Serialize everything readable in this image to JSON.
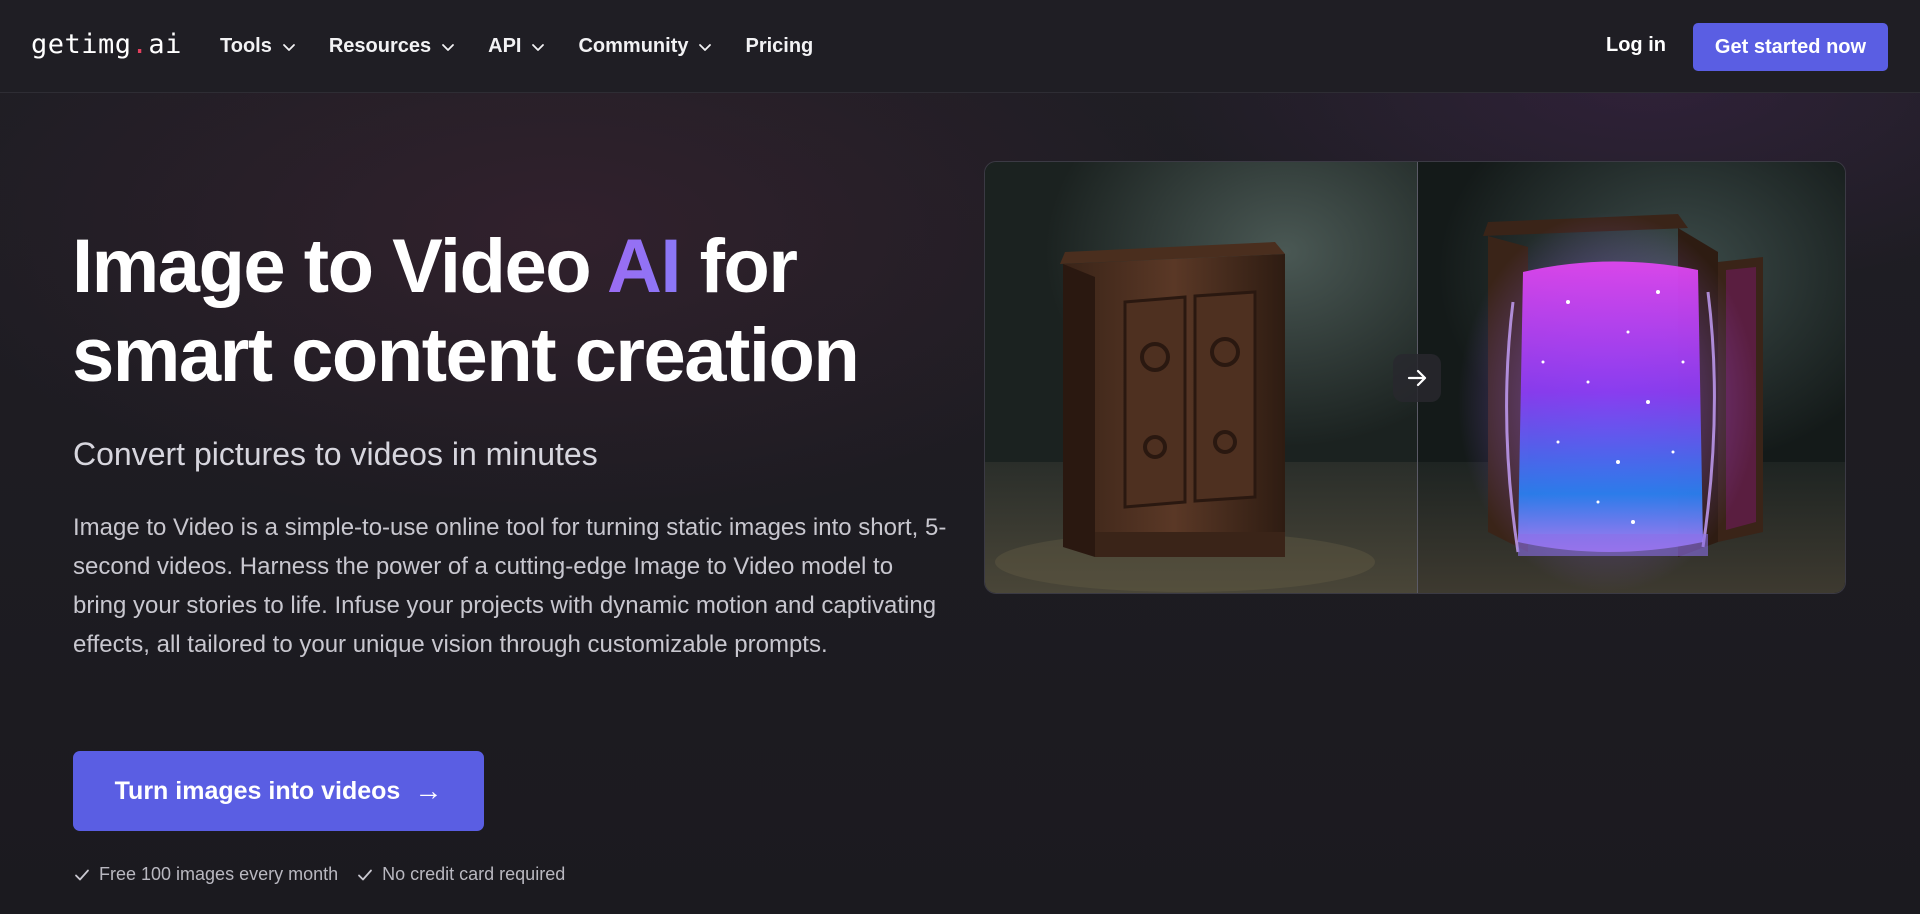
{
  "nav": {
    "logo_prefix": "getimg",
    "logo_dot": ".",
    "logo_suffix": "ai",
    "items": [
      {
        "label": "Tools",
        "has_dropdown": true
      },
      {
        "label": "Resources",
        "has_dropdown": true
      },
      {
        "label": "API",
        "has_dropdown": true
      },
      {
        "label": "Community",
        "has_dropdown": true
      },
      {
        "label": "Pricing",
        "has_dropdown": false
      }
    ],
    "login_label": "Log in",
    "cta_label": "Get started now"
  },
  "hero": {
    "title_part1": "Image to Video ",
    "title_accent": "AI",
    "title_part2": " for",
    "title_line2": "smart content creation",
    "subtitle": "Convert pictures to videos in minutes",
    "description": "Image to Video is a simple-to-use online tool for turning static images into short, 5-second videos. Harness the power of a cutting-edge Image to Video model to bring your stories to life. Infuse your projects with dynamic motion and captivating effects, all tailored to your unique vision through customizable prompts.",
    "cta_label": "Turn images into videos",
    "cta_arrow": "→",
    "perks": [
      "Free 100 images every month",
      "No credit card required"
    ]
  },
  "preview": {
    "left_icon": "wardrobe-closed-image",
    "right_icon": "wardrobe-portal-image",
    "swap_icon": "arrow-right-icon"
  },
  "colors": {
    "accent": "#5a5ee3",
    "accent_text": "#9b6cf3",
    "background": "#1c1b20",
    "logo_dot": "#e2405e"
  }
}
